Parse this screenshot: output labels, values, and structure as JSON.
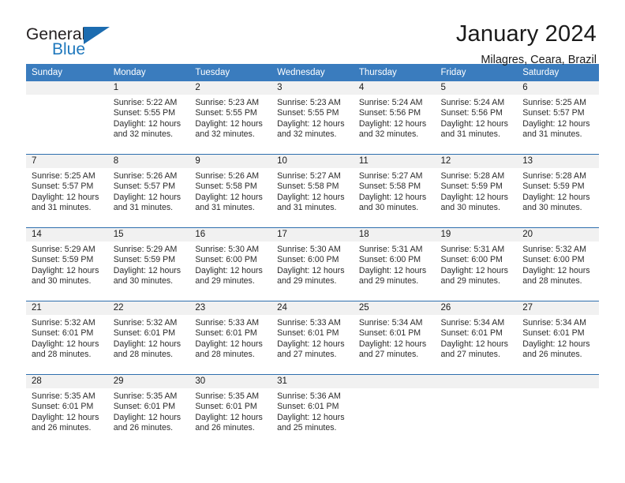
{
  "brand": {
    "name_part1": "General",
    "name_part2": "Blue",
    "logo_icon": "triangle-mark",
    "colors": {
      "dark": "#231f20",
      "blue": "#1f78bd"
    }
  },
  "header": {
    "title": "January 2024",
    "subtitle": "Milagres, Ceara, Brazil"
  },
  "calendar": {
    "accent_color": "#3a7cbe",
    "daynum_background": "#f1f1f1",
    "weekday_headers": [
      "Sunday",
      "Monday",
      "Tuesday",
      "Wednesday",
      "Thursday",
      "Friday",
      "Saturday"
    ],
    "weeks": [
      [
        {
          "day": "",
          "lines": []
        },
        {
          "day": "1",
          "lines": [
            "Sunrise: 5:22 AM",
            "Sunset: 5:55 PM",
            "Daylight: 12 hours",
            "and 32 minutes."
          ]
        },
        {
          "day": "2",
          "lines": [
            "Sunrise: 5:23 AM",
            "Sunset: 5:55 PM",
            "Daylight: 12 hours",
            "and 32 minutes."
          ]
        },
        {
          "day": "3",
          "lines": [
            "Sunrise: 5:23 AM",
            "Sunset: 5:55 PM",
            "Daylight: 12 hours",
            "and 32 minutes."
          ]
        },
        {
          "day": "4",
          "lines": [
            "Sunrise: 5:24 AM",
            "Sunset: 5:56 PM",
            "Daylight: 12 hours",
            "and 32 minutes."
          ]
        },
        {
          "day": "5",
          "lines": [
            "Sunrise: 5:24 AM",
            "Sunset: 5:56 PM",
            "Daylight: 12 hours",
            "and 31 minutes."
          ]
        },
        {
          "day": "6",
          "lines": [
            "Sunrise: 5:25 AM",
            "Sunset: 5:57 PM",
            "Daylight: 12 hours",
            "and 31 minutes."
          ]
        }
      ],
      [
        {
          "day": "7",
          "lines": [
            "Sunrise: 5:25 AM",
            "Sunset: 5:57 PM",
            "Daylight: 12 hours",
            "and 31 minutes."
          ]
        },
        {
          "day": "8",
          "lines": [
            "Sunrise: 5:26 AM",
            "Sunset: 5:57 PM",
            "Daylight: 12 hours",
            "and 31 minutes."
          ]
        },
        {
          "day": "9",
          "lines": [
            "Sunrise: 5:26 AM",
            "Sunset: 5:58 PM",
            "Daylight: 12 hours",
            "and 31 minutes."
          ]
        },
        {
          "day": "10",
          "lines": [
            "Sunrise: 5:27 AM",
            "Sunset: 5:58 PM",
            "Daylight: 12 hours",
            "and 31 minutes."
          ]
        },
        {
          "day": "11",
          "lines": [
            "Sunrise: 5:27 AM",
            "Sunset: 5:58 PM",
            "Daylight: 12 hours",
            "and 30 minutes."
          ]
        },
        {
          "day": "12",
          "lines": [
            "Sunrise: 5:28 AM",
            "Sunset: 5:59 PM",
            "Daylight: 12 hours",
            "and 30 minutes."
          ]
        },
        {
          "day": "13",
          "lines": [
            "Sunrise: 5:28 AM",
            "Sunset: 5:59 PM",
            "Daylight: 12 hours",
            "and 30 minutes."
          ]
        }
      ],
      [
        {
          "day": "14",
          "lines": [
            "Sunrise: 5:29 AM",
            "Sunset: 5:59 PM",
            "Daylight: 12 hours",
            "and 30 minutes."
          ]
        },
        {
          "day": "15",
          "lines": [
            "Sunrise: 5:29 AM",
            "Sunset: 5:59 PM",
            "Daylight: 12 hours",
            "and 30 minutes."
          ]
        },
        {
          "day": "16",
          "lines": [
            "Sunrise: 5:30 AM",
            "Sunset: 6:00 PM",
            "Daylight: 12 hours",
            "and 29 minutes."
          ]
        },
        {
          "day": "17",
          "lines": [
            "Sunrise: 5:30 AM",
            "Sunset: 6:00 PM",
            "Daylight: 12 hours",
            "and 29 minutes."
          ]
        },
        {
          "day": "18",
          "lines": [
            "Sunrise: 5:31 AM",
            "Sunset: 6:00 PM",
            "Daylight: 12 hours",
            "and 29 minutes."
          ]
        },
        {
          "day": "19",
          "lines": [
            "Sunrise: 5:31 AM",
            "Sunset: 6:00 PM",
            "Daylight: 12 hours",
            "and 29 minutes."
          ]
        },
        {
          "day": "20",
          "lines": [
            "Sunrise: 5:32 AM",
            "Sunset: 6:00 PM",
            "Daylight: 12 hours",
            "and 28 minutes."
          ]
        }
      ],
      [
        {
          "day": "21",
          "lines": [
            "Sunrise: 5:32 AM",
            "Sunset: 6:01 PM",
            "Daylight: 12 hours",
            "and 28 minutes."
          ]
        },
        {
          "day": "22",
          "lines": [
            "Sunrise: 5:32 AM",
            "Sunset: 6:01 PM",
            "Daylight: 12 hours",
            "and 28 minutes."
          ]
        },
        {
          "day": "23",
          "lines": [
            "Sunrise: 5:33 AM",
            "Sunset: 6:01 PM",
            "Daylight: 12 hours",
            "and 28 minutes."
          ]
        },
        {
          "day": "24",
          "lines": [
            "Sunrise: 5:33 AM",
            "Sunset: 6:01 PM",
            "Daylight: 12 hours",
            "and 27 minutes."
          ]
        },
        {
          "day": "25",
          "lines": [
            "Sunrise: 5:34 AM",
            "Sunset: 6:01 PM",
            "Daylight: 12 hours",
            "and 27 minutes."
          ]
        },
        {
          "day": "26",
          "lines": [
            "Sunrise: 5:34 AM",
            "Sunset: 6:01 PM",
            "Daylight: 12 hours",
            "and 27 minutes."
          ]
        },
        {
          "day": "27",
          "lines": [
            "Sunrise: 5:34 AM",
            "Sunset: 6:01 PM",
            "Daylight: 12 hours",
            "and 26 minutes."
          ]
        }
      ],
      [
        {
          "day": "28",
          "lines": [
            "Sunrise: 5:35 AM",
            "Sunset: 6:01 PM",
            "Daylight: 12 hours",
            "and 26 minutes."
          ]
        },
        {
          "day": "29",
          "lines": [
            "Sunrise: 5:35 AM",
            "Sunset: 6:01 PM",
            "Daylight: 12 hours",
            "and 26 minutes."
          ]
        },
        {
          "day": "30",
          "lines": [
            "Sunrise: 5:35 AM",
            "Sunset: 6:01 PM",
            "Daylight: 12 hours",
            "and 26 minutes."
          ]
        },
        {
          "day": "31",
          "lines": [
            "Sunrise: 5:36 AM",
            "Sunset: 6:01 PM",
            "Daylight: 12 hours",
            "and 25 minutes."
          ]
        },
        {
          "day": "",
          "lines": []
        },
        {
          "day": "",
          "lines": []
        },
        {
          "day": "",
          "lines": []
        }
      ]
    ]
  }
}
